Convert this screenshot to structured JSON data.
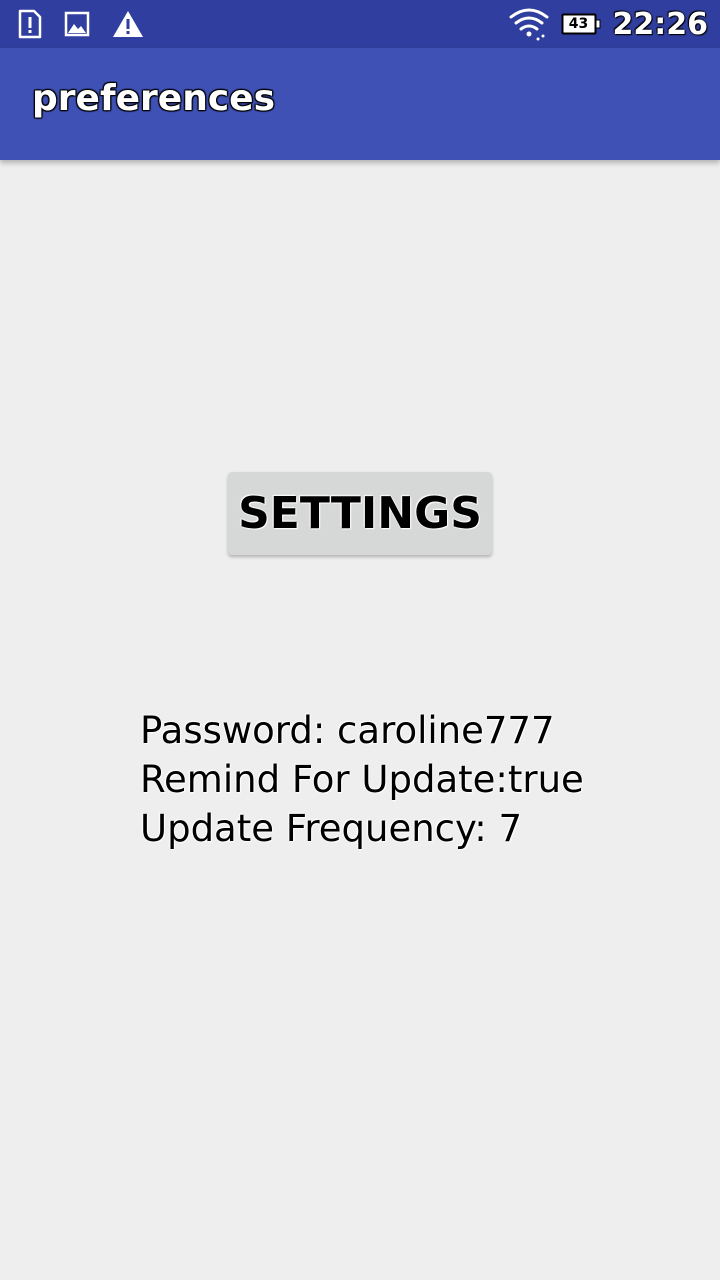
{
  "status_bar": {
    "icons_left": [
      "sim-alert-icon",
      "image-icon",
      "warning-icon"
    ],
    "icons_right": [
      "wifi-icon",
      "battery-icon"
    ],
    "battery_level": "43",
    "time": "22:26",
    "bar_color": "#303f9f"
  },
  "app_bar": {
    "title": "preferences",
    "color": "#3f51b5"
  },
  "main": {
    "settings_button_label": "SETTINGS",
    "password_line": "Password: caroline777",
    "remind_line": "Remind For Update:true",
    "frequency_line": "Update Frequency: 7"
  }
}
